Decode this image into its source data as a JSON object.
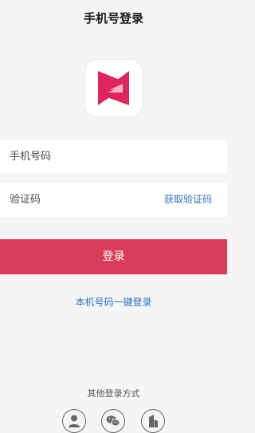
{
  "header": {
    "title": "手机号登录"
  },
  "logo": {
    "icon": "app-logo-icon",
    "colors": {
      "primary": "#e0245e",
      "light": "#f7b3c6"
    }
  },
  "form": {
    "phone_placeholder": "手机号码",
    "code_placeholder": "验证码",
    "get_code_label": "获取验证码"
  },
  "actions": {
    "login_label": "登录",
    "one_click_label": "本机号码一键登录"
  },
  "other_login": {
    "label": "其他登录方式",
    "methods": [
      {
        "icon": "user-icon"
      },
      {
        "icon": "wechat-icon"
      },
      {
        "icon": "building-icon"
      }
    ]
  },
  "colors": {
    "accent": "#da3c5c",
    "link": "#2d6fc0",
    "background": "#f5f5f5"
  }
}
